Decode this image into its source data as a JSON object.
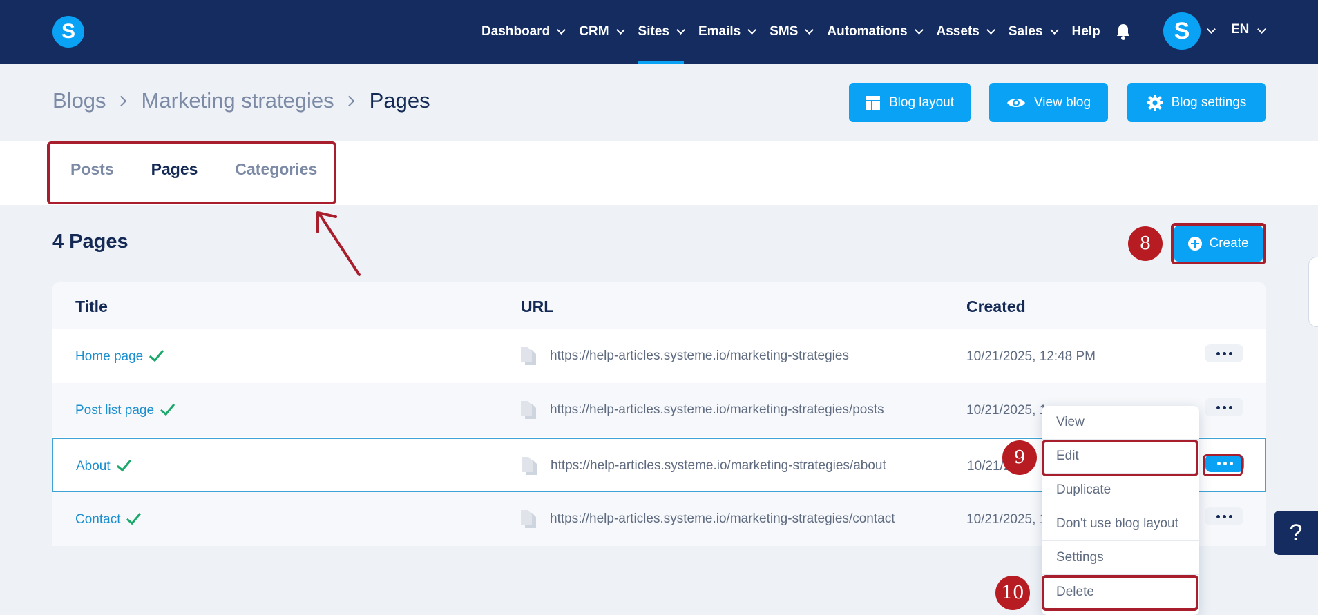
{
  "nav": {
    "items": [
      {
        "label": "Dashboard"
      },
      {
        "label": "CRM"
      },
      {
        "label": "Sites"
      },
      {
        "label": "Emails"
      },
      {
        "label": "SMS"
      },
      {
        "label": "Automations"
      },
      {
        "label": "Assets"
      },
      {
        "label": "Sales"
      },
      {
        "label": "Help"
      }
    ],
    "active": "Sites",
    "logo_letter": "S",
    "avatar_letter": "S",
    "language": "EN"
  },
  "breadcrumb": [
    "Blogs",
    "Marketing strategies",
    "Pages"
  ],
  "header_buttons": {
    "blog_layout": "Blog layout",
    "view_blog": "View blog",
    "blog_settings": "Blog settings"
  },
  "tabs": [
    {
      "label": "Posts",
      "active": false
    },
    {
      "label": "Pages",
      "active": true
    },
    {
      "label": "Categories",
      "active": false
    }
  ],
  "page_count": "4 Pages",
  "create_label": "Create",
  "table": {
    "headers": {
      "title": "Title",
      "url": "URL",
      "created": "Created"
    },
    "rows": [
      {
        "title": "Home page",
        "url": "https://help-articles.systeme.io/marketing-strategies",
        "created": "10/21/2025, 12:48 PM"
      },
      {
        "title": "Post list page",
        "url": "https://help-articles.systeme.io/marketing-strategies/posts",
        "created": "10/21/2025, 1"
      },
      {
        "title": "About",
        "url": "https://help-articles.systeme.io/marketing-strategies/about",
        "created": "10/21/2"
      },
      {
        "title": "Contact",
        "url": "https://help-articles.systeme.io/marketing-strategies/contact",
        "created": "10/21/2025, 1"
      }
    ]
  },
  "menu": {
    "items": [
      "View",
      "Edit",
      "Duplicate",
      "Don't use blog layout",
      "Settings",
      "Delete"
    ]
  },
  "annotations": {
    "badge_create": "8",
    "badge_edit": "9",
    "badge_delete": "10"
  },
  "help_fab": "?",
  "colors": {
    "navy": "#142c5f",
    "accent": "#0aa2f5",
    "highlight": "#a91e2c",
    "check": "#1aa86b"
  }
}
